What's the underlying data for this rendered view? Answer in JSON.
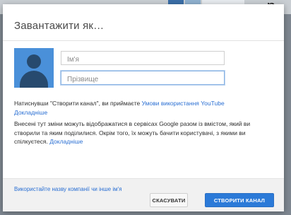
{
  "backdrop": {
    "partial_text": "р"
  },
  "dialog": {
    "title": "Завантажити як…",
    "first_name": {
      "placeholder": "Ім'я",
      "value": ""
    },
    "last_name": {
      "placeholder": "Прізвище",
      "value": ""
    },
    "terms": {
      "text": "Натиснувши \"Створити канал\", ви приймаєте ",
      "terms_link": "Умови використання YouTube",
      "learn_more": "Докладніше"
    },
    "notice": {
      "text": "Внесені тут зміни можуть відображатися в сервісах Google разом із вмістом, який ви створили та яким поділилися. Окрім того, їх можуть бачити користувачі, з якими ви спілкуєтеся. ",
      "learn_more": "Докладніше"
    },
    "footer": {
      "alt_link": "Використайте назву компанії чи інше ім'я",
      "cancel_label": "СКАСУВАТИ",
      "create_label": "СТВОРИТИ КАНАЛ"
    }
  },
  "colors": {
    "accent": "#2b7ad8",
    "link": "#2a6fd3",
    "avatar_bg": "#4a90d9"
  },
  "icons": {
    "avatar": "default-user-avatar-icon"
  }
}
